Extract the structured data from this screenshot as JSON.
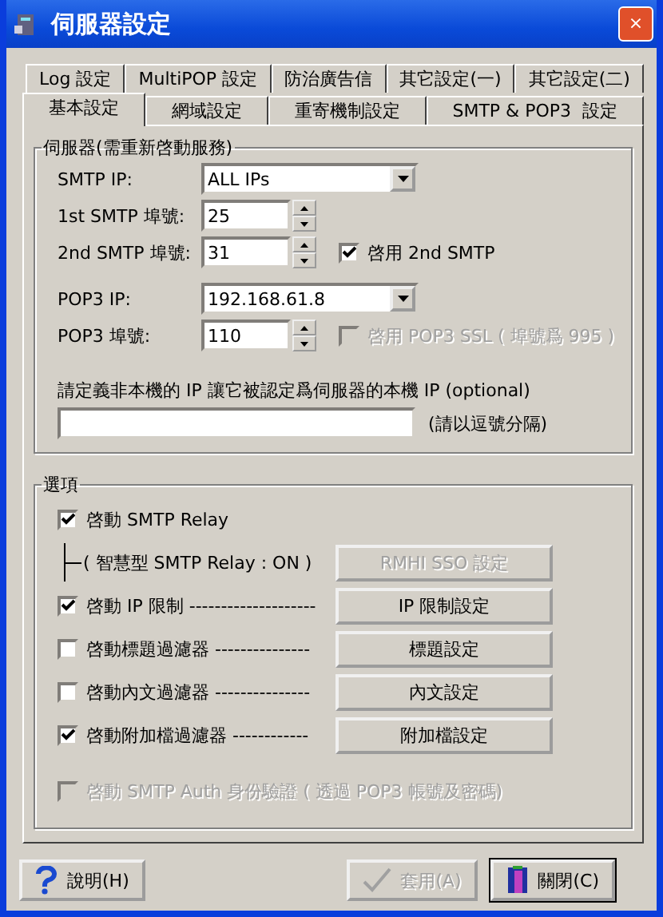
{
  "window": {
    "title": "伺服器設定",
    "close": "×"
  },
  "tab_rows": [
    [
      {
        "label": "Log 設定",
        "selected": false
      },
      {
        "label": "MultiPOP 設定",
        "selected": false
      },
      {
        "label": "防治廣告信",
        "selected": false
      },
      {
        "label": "其它設定(一)",
        "selected": false
      },
      {
        "label": "其它設定(二)",
        "selected": false
      }
    ],
    [
      {
        "label": "基本設定",
        "selected": true
      },
      {
        "label": "網域設定",
        "selected": false
      },
      {
        "label": "重寄機制設定",
        "selected": false
      },
      {
        "label": "SMTP & POP3  設定",
        "selected": false
      }
    ]
  ],
  "server": {
    "title": "伺服器(需重新啓動服務)",
    "rows": [
      {
        "kind": "dropdown",
        "label": "SMTP IP:",
        "value": "ALL IPs"
      },
      {
        "kind": "spinner",
        "label": "1st SMTP 埠號:",
        "value": "25"
      },
      {
        "kind": "spinner",
        "label": "2nd SMTP 埠號:",
        "value": "31",
        "checkbox": {
          "label": "啓用 2nd SMTP",
          "checked": true,
          "disabled": false
        }
      },
      {
        "kind": "dropdown",
        "label": "POP3 IP:",
        "value": "192.168.61.8"
      },
      {
        "kind": "spinner",
        "label": "POP3 埠號:",
        "value": "110",
        "checkbox": {
          "label": "啓用 POP3 SSL ( 埠號爲 995 )",
          "checked": false,
          "disabled": true
        }
      }
    ],
    "local_ip_prompt": "請定義非本機的 IP 讓它被認定爲伺服器的本機 IP (optional)",
    "local_ip_hint": "(請以逗號分隔)"
  },
  "options": {
    "title": "選項",
    "items": [
      {
        "kind": "check",
        "label": "啓動 SMTP Relay",
        "checked": true,
        "disabled": false
      },
      {
        "kind": "note",
        "label": "( 智慧型 SMTP Relay : ON )",
        "button": {
          "label": "RMHI SSO 設定",
          "disabled": true
        }
      },
      {
        "kind": "check",
        "label": "啓動 IP 限制 --------------------",
        "checked": true,
        "disabled": false,
        "button": {
          "label": "IP 限制設定",
          "disabled": false
        }
      },
      {
        "kind": "check",
        "label": "啓動標題過濾器 ---------------",
        "checked": false,
        "disabled": false,
        "button": {
          "label": "標題設定",
          "disabled": false
        }
      },
      {
        "kind": "check",
        "label": "啓動內文過濾器 ---------------",
        "checked": false,
        "disabled": false,
        "button": {
          "label": "內文設定",
          "disabled": false
        }
      },
      {
        "kind": "check",
        "label": "啓動附加檔過濾器 ------------",
        "checked": true,
        "disabled": false,
        "button": {
          "label": "附加檔設定",
          "disabled": false
        }
      },
      {
        "kind": "check",
        "label": "啓動 SMTP Auth 身份驗證 ( 透過 POP3 帳號及密碼)",
        "checked": false,
        "disabled": true
      }
    ]
  },
  "footer": [
    {
      "kind": "help",
      "label": "說明(H)",
      "disabled": false,
      "default": false
    },
    {
      "kind": "apply",
      "label": "套用(A)",
      "disabled": true,
      "default": false
    },
    {
      "kind": "close",
      "label": "關閉(C)",
      "disabled": false,
      "default": true
    }
  ]
}
